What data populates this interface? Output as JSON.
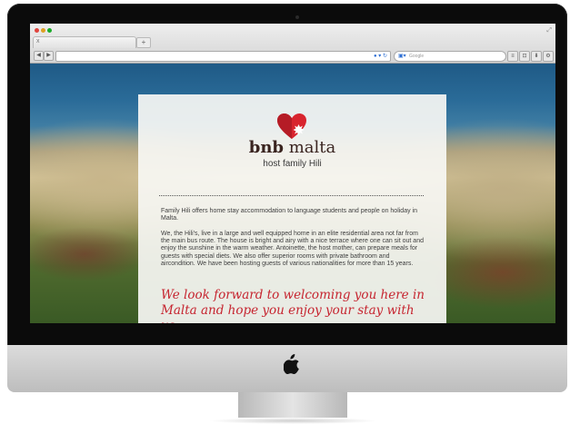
{
  "browser": {
    "search_placeholder": "Google",
    "tab_close": "x",
    "new_tab": "+"
  },
  "site": {
    "brand_bold": "bnb",
    "brand_regular": "malta",
    "tagline": "host family Hili",
    "paragraph1": "Family Hili offers home stay accommodation to language students and people on holiday in Malta.",
    "paragraph2": "We, the Hili's, live in a large and well equipped home in an elite residential area not far from the main bus route. The house is bright and airy with a nice terrace where one can sit out and enjoy the sunshine in the warm weather. Antoinette, the host mother, can prepare meals for guests with special diets. We also offer superior rooms with private bathroom and aircondition. We have been hosting guests of various nationalities for more than 15 years.",
    "welcome": "We look forward to welcoming you here in Malta and hope you enjoy your stay with us."
  },
  "colors": {
    "accent_red": "#c62530",
    "brand_text": "#3a2420"
  },
  "icons": {
    "logo": "red-heart-with-maltese-cross",
    "device_logo": "apple-logo"
  }
}
